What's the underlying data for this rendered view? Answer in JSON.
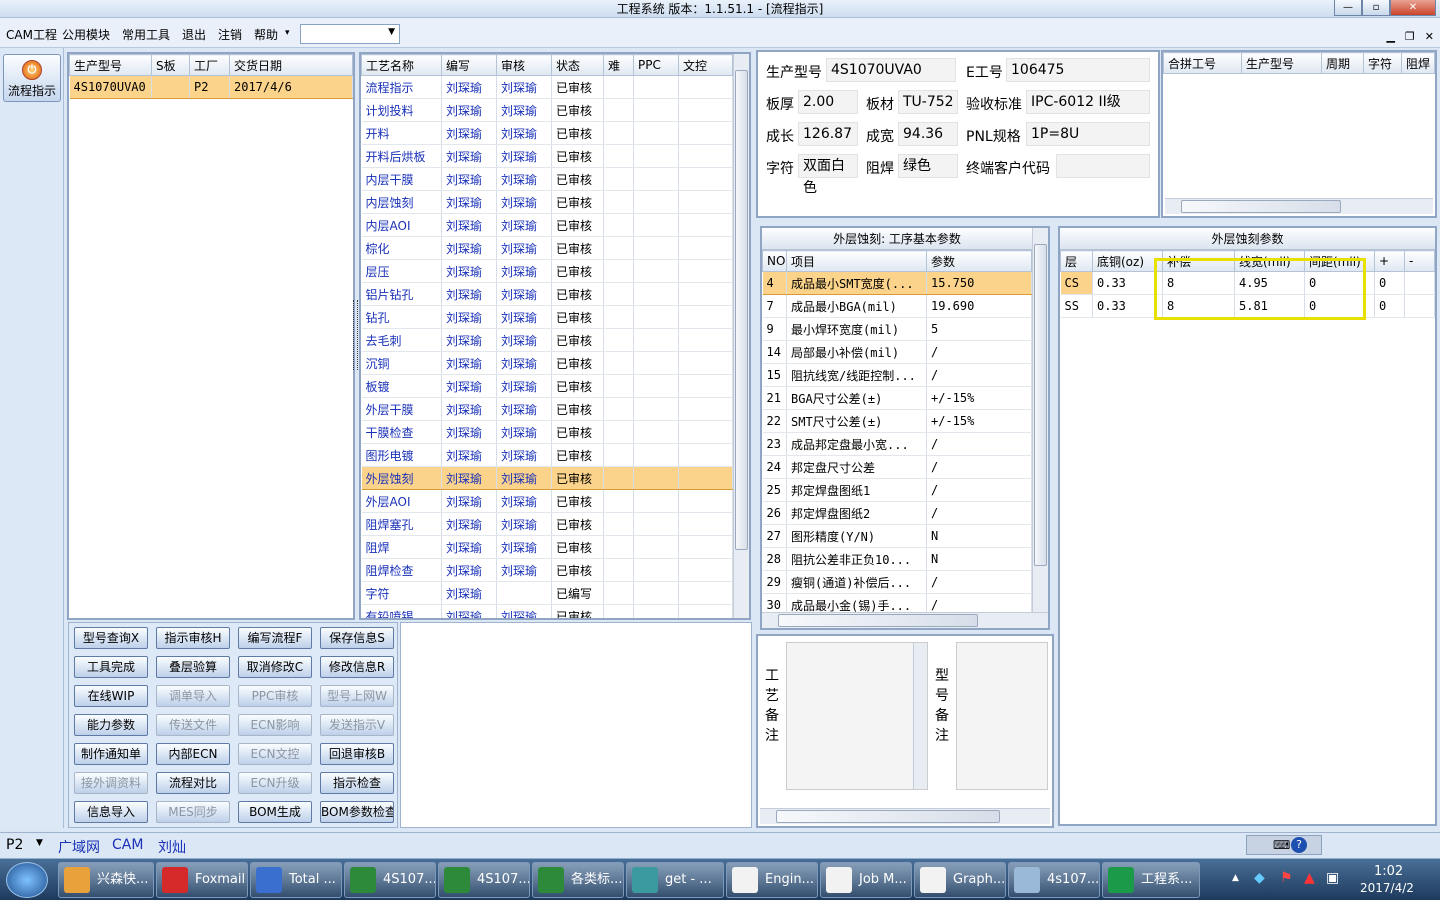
{
  "window": {
    "title": "工程系统   版本：1.1.51.1 - [流程指示]"
  },
  "menu": {
    "items": [
      "CAM工程",
      "公用模块",
      "常用工具",
      "退出",
      "注销",
      "帮助"
    ],
    "help_arrow": "▾",
    "combo_value": ""
  },
  "leftbar": {
    "flow_button": "流程指示"
  },
  "product_grid": {
    "headers": [
      "生产型号",
      "S板",
      "工厂",
      "交货日期"
    ],
    "rows": [
      [
        "4S1070UVA0",
        "",
        "P2",
        "2017/4/6"
      ]
    ]
  },
  "process_grid": {
    "headers": [
      "工艺名称",
      "编写",
      "审核",
      "状态",
      "难",
      "PPC",
      "文控"
    ],
    "rows": [
      [
        "流程指示",
        "刘琛瑜",
        "刘琛瑜",
        "已审核"
      ],
      [
        "计划投料",
        "刘琛瑜",
        "刘琛瑜",
        "已审核"
      ],
      [
        "开料",
        "刘琛瑜",
        "刘琛瑜",
        "已审核"
      ],
      [
        "开料后烘板",
        "刘琛瑜",
        "刘琛瑜",
        "已审核"
      ],
      [
        "内层干膜",
        "刘琛瑜",
        "刘琛瑜",
        "已审核"
      ],
      [
        "内层蚀刻",
        "刘琛瑜",
        "刘琛瑜",
        "已审核"
      ],
      [
        "内层AOI",
        "刘琛瑜",
        "刘琛瑜",
        "已审核"
      ],
      [
        "棕化",
        "刘琛瑜",
        "刘琛瑜",
        "已审核"
      ],
      [
        "层压",
        "刘琛瑜",
        "刘琛瑜",
        "已审核"
      ],
      [
        "铝片钻孔",
        "刘琛瑜",
        "刘琛瑜",
        "已审核"
      ],
      [
        "钻孔",
        "刘琛瑜",
        "刘琛瑜",
        "已审核"
      ],
      [
        "去毛刺",
        "刘琛瑜",
        "刘琛瑜",
        "已审核"
      ],
      [
        "沉铜",
        "刘琛瑜",
        "刘琛瑜",
        "已审核"
      ],
      [
        "板镀",
        "刘琛瑜",
        "刘琛瑜",
        "已审核"
      ],
      [
        "外层干膜",
        "刘琛瑜",
        "刘琛瑜",
        "已审核"
      ],
      [
        "干膜检查",
        "刘琛瑜",
        "刘琛瑜",
        "已审核"
      ],
      [
        "图形电镀",
        "刘琛瑜",
        "刘琛瑜",
        "已审核"
      ],
      [
        "外层蚀刻",
        "刘琛瑜",
        "刘琛瑜",
        "已审核"
      ],
      [
        "外层AOI",
        "刘琛瑜",
        "刘琛瑜",
        "已审核"
      ],
      [
        "阻焊塞孔",
        "刘琛瑜",
        "刘琛瑜",
        "已审核"
      ],
      [
        "阻焊",
        "刘琛瑜",
        "刘琛瑜",
        "已审核"
      ],
      [
        "阻焊检查",
        "刘琛瑜",
        "刘琛瑜",
        "已审核"
      ],
      [
        "字符",
        "刘琛瑜",
        "",
        "已编写"
      ],
      [
        "有铅喷锡",
        "刘琛瑜",
        "刘琛瑜",
        "已审核"
      ]
    ],
    "selected_index": 17
  },
  "buttons": [
    {
      "label": "型号查询X",
      "enabled": true
    },
    {
      "label": "指示审核H",
      "enabled": true
    },
    {
      "label": "编写流程F",
      "enabled": true
    },
    {
      "label": "保存信息S",
      "enabled": true
    },
    {
      "label": "工具完成",
      "enabled": true
    },
    {
      "label": "叠层验算",
      "enabled": true
    },
    {
      "label": "取消修改C",
      "enabled": true
    },
    {
      "label": "修改信息R",
      "enabled": true
    },
    {
      "label": "在线WIP",
      "enabled": true
    },
    {
      "label": "调单导入",
      "enabled": false
    },
    {
      "label": "PPC审核",
      "enabled": false
    },
    {
      "label": "型号上网W",
      "enabled": false
    },
    {
      "label": "能力参数",
      "enabled": true
    },
    {
      "label": "传送文件",
      "enabled": false
    },
    {
      "label": "ECN影响",
      "enabled": false
    },
    {
      "label": "发送指示V",
      "enabled": false
    },
    {
      "label": "制作通知单",
      "enabled": true
    },
    {
      "label": "内部ECN",
      "enabled": true
    },
    {
      "label": "ECN文控",
      "enabled": false
    },
    {
      "label": "回退审核B",
      "enabled": true
    },
    {
      "label": "接外调资料",
      "enabled": false
    },
    {
      "label": "流程对比",
      "enabled": true
    },
    {
      "label": "ECN升级",
      "enabled": false
    },
    {
      "label": "指示检查",
      "enabled": true
    },
    {
      "label": "信息导入",
      "enabled": true
    },
    {
      "label": "MES同步",
      "enabled": false
    },
    {
      "label": "BOM生成",
      "enabled": true
    },
    {
      "label": "BOM参数检查",
      "enabled": true
    }
  ],
  "info": {
    "prod_model_label": "生产型号",
    "prod_model": "4S1070UVA0",
    "eno_label": "E工号",
    "eno": "106475",
    "thick_label": "板厚",
    "thick": "2.00",
    "material_label": "板材",
    "material": "TU-752",
    "accept_label": "验收标准",
    "accept": "IPC-6012 II级",
    "len_label": "成长",
    "len": "126.87",
    "wid_label": "成宽",
    "wid": "94.36",
    "pnl_label": "PNL规格",
    "pnl": "1P=8U",
    "char_label": "字符",
    "char": "双面白色",
    "mask_label": "阻焊",
    "mask": "绿色",
    "customer_label": "终端客户代码",
    "customer": ""
  },
  "merge_grid": {
    "headers": [
      "合拼工号",
      "生产型号",
      "周期",
      "字符",
      "阻焊"
    ]
  },
  "basic_params": {
    "title": "外层蚀刻: 工序基本参数",
    "headers": [
      "NO",
      "项目",
      "参数"
    ],
    "rows": [
      [
        "4",
        "成品最小SMT宽度(...",
        "15.750"
      ],
      [
        "7",
        "成品最小BGA(mil)",
        "19.690"
      ],
      [
        "9",
        "最小焊环宽度(mil)",
        "5"
      ],
      [
        "14",
        "局部最小补偿(mil)",
        "/"
      ],
      [
        "15",
        "阻抗线宽/线距控制...",
        "/"
      ],
      [
        "21",
        "BGA尺寸公差(±)",
        "+/-15%"
      ],
      [
        "22",
        "SMT尺寸公差(±)",
        "+/-15%"
      ],
      [
        "23",
        "成品邦定盘最小宽...",
        "/"
      ],
      [
        "24",
        "邦定盘尺寸公差",
        "/"
      ],
      [
        "25",
        "邦定焊盘图纸1",
        "/"
      ],
      [
        "26",
        "邦定焊盘图纸2",
        "/"
      ],
      [
        "27",
        "图形精度(Y/N)",
        "N"
      ],
      [
        "28",
        "阻抗公差非正负10...",
        "N"
      ],
      [
        "29",
        "瘦铜(通道)补偿后...",
        "/"
      ],
      [
        "30",
        "成品最小金(锡)手...",
        "/"
      ]
    ]
  },
  "etch_params": {
    "title": "外层蚀刻参数",
    "headers": [
      "层",
      "底铜(oz)",
      "补偿",
      "线宽(mil)",
      "间距(mil)",
      "+",
      "-"
    ],
    "rows": [
      [
        "CS",
        "0.33",
        "8",
        "4.95",
        "0",
        "0",
        ""
      ],
      [
        "SS",
        "0.33",
        "8",
        "5.81",
        "0",
        "0",
        ""
      ]
    ]
  },
  "remarks": {
    "process_label": "工艺备注",
    "model_label": "型号备注"
  },
  "statusbar": {
    "factory": "P2",
    "items": [
      "广域网",
      "CAM",
      "刘灿"
    ]
  },
  "taskbar": {
    "apps": [
      "兴森快...",
      "Foxmail",
      "Total ...",
      "4S107...",
      "4S107...",
      "各类标...",
      "get - ...",
      "Engin...",
      "Job M...",
      "Graph...",
      "4s107...",
      "工程系..."
    ],
    "time": "1:02",
    "date": "2017/4/2"
  },
  "colors": {
    "accent": "#fbd38a",
    "link": "#1a31b8",
    "highlight": "#e8e000"
  }
}
